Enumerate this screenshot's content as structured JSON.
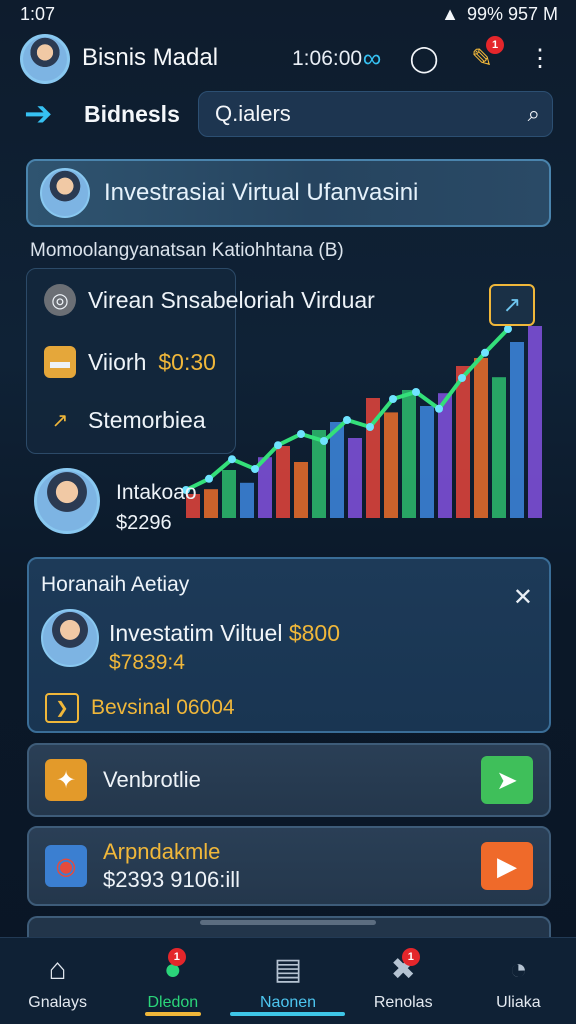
{
  "status": {
    "time": "1:07",
    "right": "99%  957 M"
  },
  "header": {
    "app_name": "Bisnis Madal",
    "coins": "1:06:00",
    "notification_count": "1"
  },
  "nav": {
    "title": "Bidnesls",
    "search_value": "Q.ialers"
  },
  "banner": {
    "text": "Investrasiai Virtual Ufanvasini"
  },
  "subtitle": "Momoolangyanatsan Katiohhtana  (B)",
  "chart_panel": {
    "item1": "Virean Snsabeloriah Virduar",
    "item2_label": "Viiorh",
    "item2_value": "$0:30",
    "item3": "Stemorbiea",
    "user_name": "Intakoao",
    "user_value": "$2296"
  },
  "chart_data": {
    "type": "bar",
    "categories": [],
    "values": [
      15,
      18,
      30,
      22,
      38,
      45,
      35,
      55,
      60,
      50,
      75,
      66,
      80,
      70,
      78,
      95,
      100,
      88,
      110,
      120
    ],
    "series_colors": [
      "#d9423b",
      "#e06a2b",
      "#2bb56a",
      "#3b82d6",
      "#7c4fd6"
    ],
    "trend_line": [
      20,
      28,
      42,
      35,
      52,
      60,
      55,
      70,
      65,
      85,
      90,
      78,
      100,
      118,
      135
    ]
  },
  "card": {
    "title": "Horanaih Aetiay",
    "product_name": "Investatim Viltuel",
    "product_amount": "$800",
    "product_value": "$7839:4",
    "tag_label": "Bevsinal 06004"
  },
  "list": [
    {
      "label": "Venbrotlie",
      "sublabel": ""
    },
    {
      "label": "Arpndakmle",
      "sublabel": "$2393 9106:ill"
    }
  ],
  "bottom_nav": [
    {
      "label": "Gnalays",
      "badge": ""
    },
    {
      "label": "Dledon",
      "badge": "1"
    },
    {
      "label": "Naonen",
      "badge": ""
    },
    {
      "label": "Renolas",
      "badge": "1"
    },
    {
      "label": "Uliaka",
      "badge": ""
    }
  ],
  "colors": {
    "accent": "#36c1f2",
    "gold": "#f0b73a",
    "green": "#2bd57a",
    "orange": "#f06a2a"
  }
}
